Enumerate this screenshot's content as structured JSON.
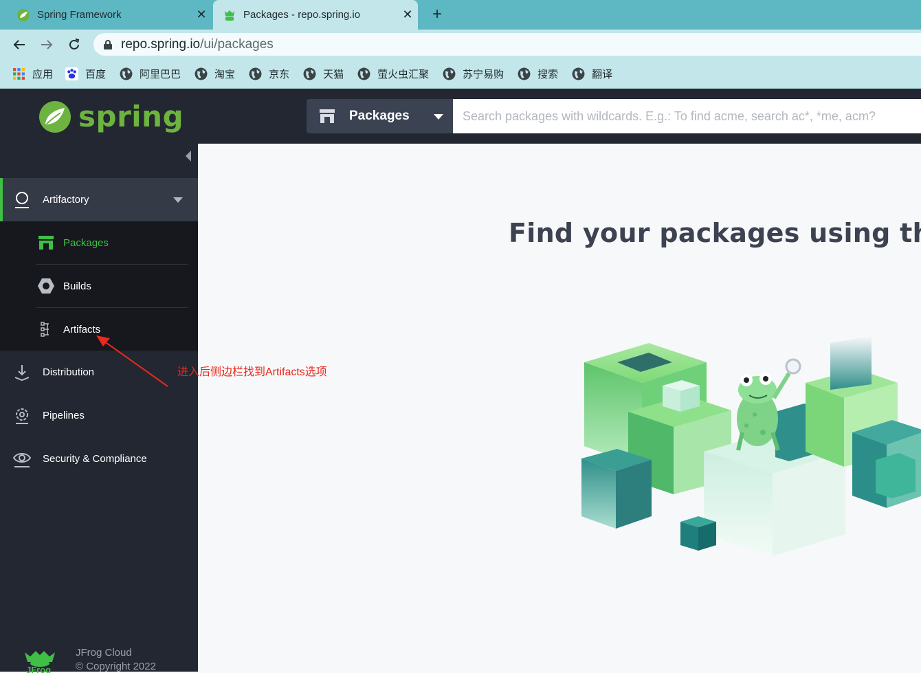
{
  "browser": {
    "tabs": [
      {
        "title": "Spring Framework",
        "close": "✕"
      },
      {
        "title": "Packages - repo.spring.io",
        "close": "✕"
      }
    ],
    "new_tab": "+",
    "url_main": "repo.spring.io",
    "url_path": "/ui/packages",
    "bookmarks": [
      {
        "label": "应用",
        "icon": "apps-grid-icon"
      },
      {
        "label": "百度",
        "icon": "baidu-paw-icon"
      },
      {
        "label": "阿里巴巴",
        "icon": "globe-icon"
      },
      {
        "label": "淘宝",
        "icon": "globe-icon"
      },
      {
        "label": "京东",
        "icon": "globe-icon"
      },
      {
        "label": "天猫",
        "icon": "globe-icon"
      },
      {
        "label": "萤火虫汇聚",
        "icon": "globe-icon"
      },
      {
        "label": "苏宁易购",
        "icon": "globe-icon"
      },
      {
        "label": "搜索",
        "icon": "globe-icon"
      },
      {
        "label": "翻译",
        "icon": "globe-icon"
      }
    ]
  },
  "header": {
    "logo_text": "spring",
    "package_type_selected": "Packages",
    "search_placeholder": "Search packages with wildcards. E.g.: To find acme, search ac*, *me, acm?"
  },
  "sidebar": {
    "artifactory_label": "Artifactory",
    "sub_items": [
      {
        "label": "Packages",
        "icon": "packages-icon",
        "active": true
      },
      {
        "label": "Builds",
        "icon": "builds-hexagon-icon",
        "active": false
      },
      {
        "label": "Artifacts",
        "icon": "artifacts-tree-icon",
        "active": false
      }
    ],
    "items": [
      {
        "label": "Distribution",
        "icon": "distribution-icon"
      },
      {
        "label": "Pipelines",
        "icon": "pipelines-gear-icon"
      },
      {
        "label": "Security & Compliance",
        "icon": "security-eye-icon"
      }
    ],
    "footer": {
      "product": "JFrog Cloud",
      "copyright": "© Copyright 2022",
      "logo_text": "JFrog"
    }
  },
  "main": {
    "headline": "Find your packages using the Sea"
  },
  "annotation": {
    "text": "进入后侧边栏找到Artifacts选项"
  },
  "colors": {
    "tab_bar": "#5db8c4",
    "chrome_light": "#c3e6ea",
    "sidebar_bg": "#232732",
    "sidebar_active_bg": "#353a47",
    "accent_green": "#40be46",
    "spring_green": "#6db33f",
    "annotation_red": "#e8291c"
  }
}
